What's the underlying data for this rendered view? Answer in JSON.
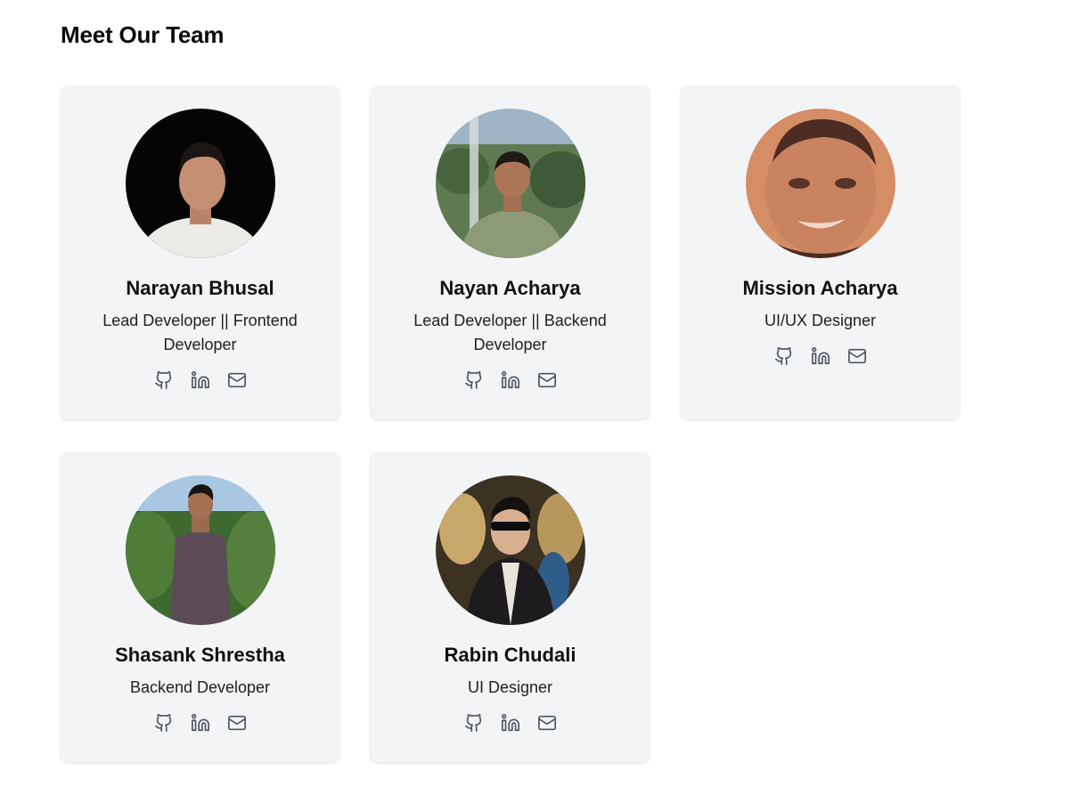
{
  "page": {
    "title": "Meet Our Team"
  },
  "members": [
    {
      "name": "Narayan Bhusal",
      "role": "Lead Developer || Frontend Developer",
      "photo": "photo-dark-background"
    },
    {
      "name": "Nayan Acharya",
      "role": "Lead Developer || Backend Developer",
      "photo": "photo-outdoor-window"
    },
    {
      "name": "Mission Acharya",
      "role": "UI/UX Designer",
      "photo": "photo-sepia-tone"
    },
    {
      "name": "Shasank Shrestha",
      "role": "Backend Developer",
      "photo": "photo-garden"
    },
    {
      "name": "Rabin Chudali",
      "role": "UI Designer",
      "photo": "photo-evening-lights"
    }
  ],
  "icons": {
    "github": "github-icon",
    "linkedin": "linkedin-icon",
    "email": "mail-icon"
  },
  "colors": {
    "card_bg": "#f3f4f6",
    "icon": "#4b5563",
    "text": "#111111"
  }
}
